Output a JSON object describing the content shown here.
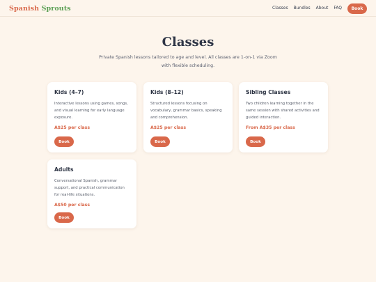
{
  "header": {
    "logo_word1": "Spanish",
    "logo_word2": "Sprouts",
    "nav": [
      "Classes",
      "Bundles",
      "About",
      "FAQ"
    ],
    "book_label": "Book"
  },
  "main": {
    "title": "Classes",
    "subtitle": "Private Spanish lessons tailored to age and level. All classes are 1-on-1 via Zoom with flexible scheduling."
  },
  "cards": [
    {
      "title": "Kids (4–7)",
      "description": "Interactive lessons using games, songs, and visual learning for early language exposure.",
      "price": "A$25 per class",
      "button": "Book"
    },
    {
      "title": "Kids (8–12)",
      "description": "Structured lessons focusing on vocabulary, grammar basics, speaking and comprehension.",
      "price": "A$25 per class",
      "button": "Book"
    },
    {
      "title": "Sibling Classes",
      "description": "Two children learning together in the same session with shared activities and guided interaction.",
      "price": "From A$35 per class",
      "button": "Book"
    },
    {
      "title": "Adults",
      "description": "Conversational Spanish, grammar support, and practical communication for real-life situations.",
      "price": "A$50 per class",
      "button": "Book"
    }
  ],
  "colors": {
    "background": "#fdf5ec",
    "accent": "#d9684a",
    "logo_green": "#5c9f54",
    "heading": "#2e3546"
  }
}
